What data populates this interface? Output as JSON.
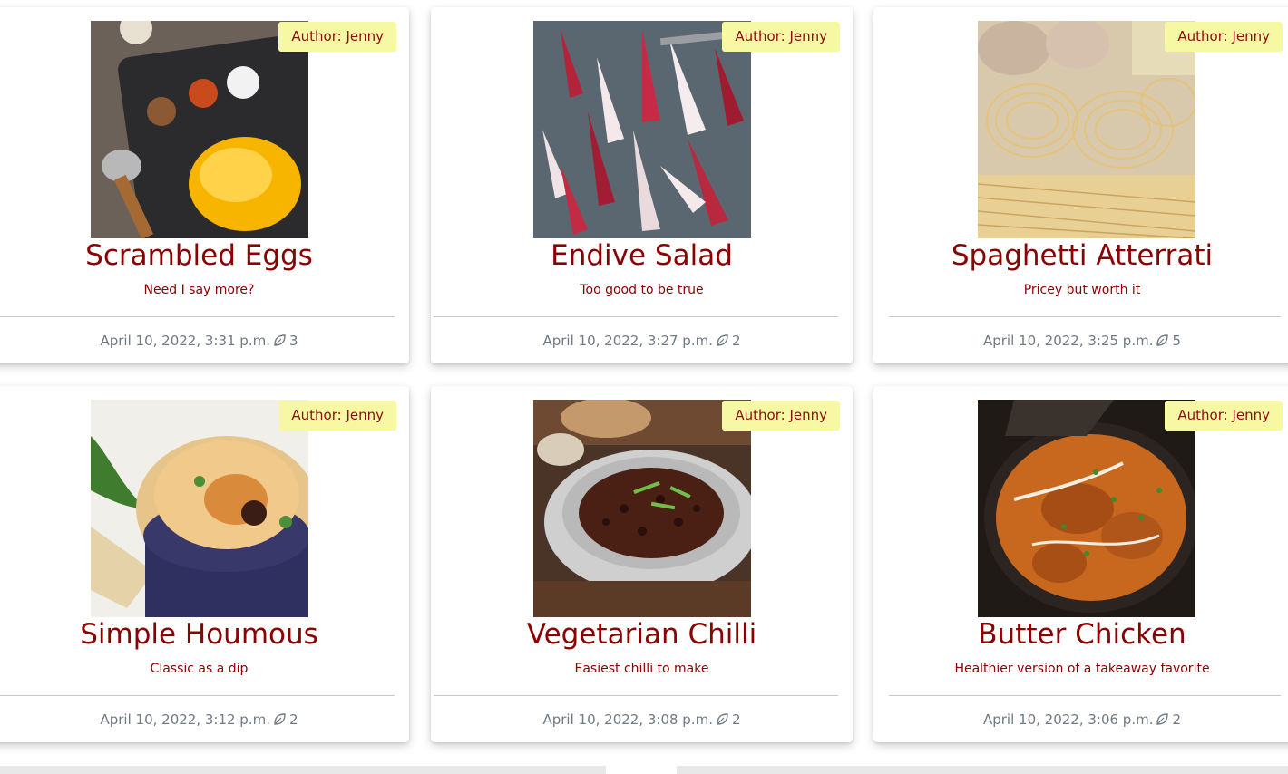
{
  "posts": [
    {
      "author_label": "Author: Jenny",
      "title": "Scrambled Eggs",
      "excerpt": "Need I say more?",
      "date": "April 10, 2022, 3:31 p.m.",
      "likes": "3",
      "image": "scrambled-eggs-image"
    },
    {
      "author_label": "Author: Jenny",
      "title": "Endive Salad",
      "excerpt": "Too good to be true",
      "date": "April 10, 2022, 3:27 p.m.",
      "likes": "2",
      "image": "endive-salad-image"
    },
    {
      "author_label": "Author: Jenny",
      "title": "Spaghetti Atterrati",
      "excerpt": "Pricey but worth it",
      "date": "April 10, 2022, 3:25 p.m.",
      "likes": "5",
      "image": "spaghetti-image"
    },
    {
      "author_label": "Author: Jenny",
      "title": "Simple Houmous",
      "excerpt": "Classic as a dip",
      "date": "April 10, 2022, 3:12 p.m.",
      "likes": "2",
      "image": "houmous-image"
    },
    {
      "author_label": "Author: Jenny",
      "title": "Vegetarian Chilli",
      "excerpt": "Easiest chilli to make",
      "date": "April 10, 2022, 3:08 p.m.",
      "likes": "2",
      "image": "chilli-image"
    },
    {
      "author_label": "Author: Jenny",
      "title": "Butter Chicken",
      "excerpt": "Healthier version of a takeaway favorite",
      "date": "April 10, 2022, 3:06 p.m.",
      "likes": "2",
      "image": "butter-chicken-image"
    }
  ],
  "icons": {
    "likes": "leaf-icon"
  },
  "colors": {
    "title": "#8b0000",
    "badge_bg": "#f6f8a4",
    "meta": "#707a83"
  }
}
